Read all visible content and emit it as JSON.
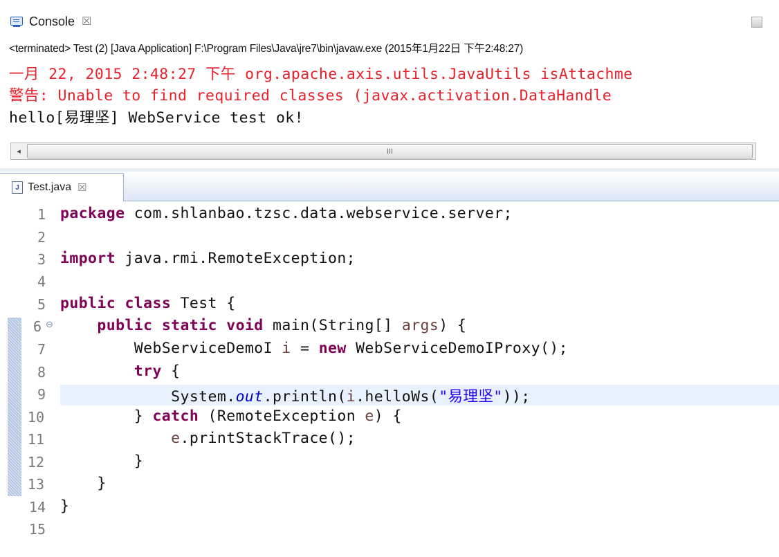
{
  "console": {
    "tab_label": "Console",
    "tab_close": "☒",
    "header": "<terminated> Test (2) [Java Application] F:\\Program Files\\Java\\jre7\\bin\\javaw.exe (2015年1月22日 下午2:48:27)",
    "lines": [
      "一月 22, 2015 2:48:27 下午 org.apache.axis.utils.JavaUtils isAttachme",
      "警告: Unable to find required classes (javax.activation.DataHandle",
      "hello[易理坚] WebService test ok!"
    ],
    "scroll_left_arrow": "◂",
    "scroll_grip": "III"
  },
  "editor": {
    "tab_label": "Test.java",
    "tab_close": "☒",
    "tab_icon_letter": "J",
    "fold_marker": "⊖",
    "line_numbers": [
      "1",
      "2",
      "3",
      "4",
      "5",
      "6",
      "7",
      "8",
      "9",
      "10",
      "11",
      "12",
      "13",
      "14",
      "15"
    ],
    "code": {
      "l1_kw": "package",
      "l1_rest": " com.shlanbao.tzsc.data.webservice.server;",
      "l3_kw": "import",
      "l3_rest": " java.rmi.RemoteException;",
      "l5_kw1": "public",
      "l5_kw2": "class",
      "l5_rest": " Test {",
      "l6_indent": "    ",
      "l6_kw1": "public",
      "l6_kw2": "static",
      "l6_kw3": "void",
      "l6_mid": " main(String[] ",
      "l6_var": "args",
      "l6_end": ") {",
      "l7_indent": "        ",
      "l7_type": "WebServiceDemoI ",
      "l7_var": "i",
      "l7_mid": " = ",
      "l7_kw": "new",
      "l7_end": " WebServiceDemoIProxy();",
      "l8_indent": "        ",
      "l8_kw": "try",
      "l8_end": " {",
      "l9_indent": "            ",
      "l9_a": "System.",
      "l9_field": "out",
      "l9_b": ".println(",
      "l9_var": "i",
      "l9_c": ".helloWs(",
      "l9_str": "\"易理坚\"",
      "l9_d": "));",
      "l10_indent": "        } ",
      "l10_kw": "catch",
      "l10_mid": " (RemoteException ",
      "l10_var": "e",
      "l10_end": ") {",
      "l11_indent": "            ",
      "l11_var": "e",
      "l11_end": ".printStackTrace();",
      "l12": "        }",
      "l13": "    }",
      "l14": "}"
    }
  }
}
